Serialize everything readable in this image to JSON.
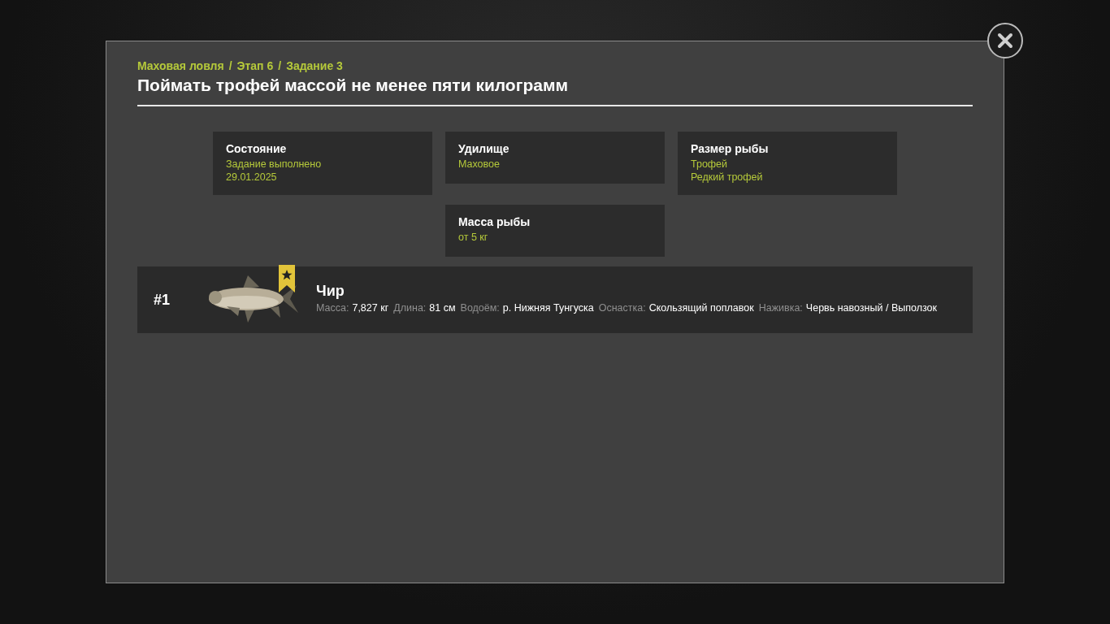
{
  "breadcrumb": {
    "items": [
      "Маховая ловля",
      "Этап 6",
      "Задание 3"
    ],
    "separator": "/"
  },
  "title": "Поймать трофей массой не менее пяти килограмм",
  "cards": [
    {
      "heading": "Состояние",
      "lines": [
        "Задание выполнено",
        "29.01.2025"
      ]
    },
    {
      "heading": "Удилище",
      "lines": [
        "Маховое"
      ]
    },
    {
      "heading": "Размер рыбы",
      "lines": [
        "Трофей",
        "Редкий трофей"
      ]
    },
    {
      "heading": "Масса рыбы",
      "lines": [
        "от 5 кг"
      ]
    }
  ],
  "catches": [
    {
      "rank": "#1",
      "name": "Чир",
      "trophy_badge": true,
      "details": [
        {
          "label": "Масса:",
          "value": "7,827 кг"
        },
        {
          "label": "Длина:",
          "value": "81 см"
        },
        {
          "label": "Водоём:",
          "value": "р. Нижняя Тунгуска"
        },
        {
          "label": "Оснастка:",
          "value": "Скользящий поплавок"
        },
        {
          "label": "Наживка:",
          "value": "Червь навозный / Выползок"
        }
      ]
    }
  ]
}
